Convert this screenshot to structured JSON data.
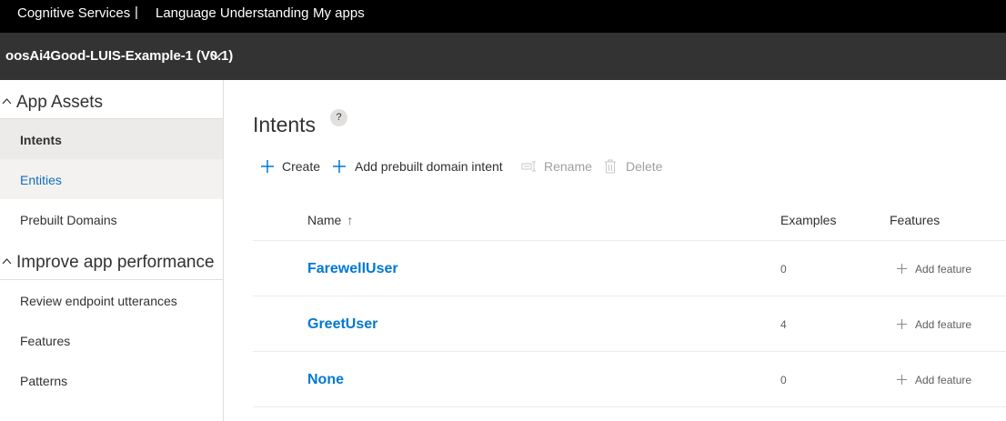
{
  "topnav": {
    "brand": "Cognitive Services",
    "separator": "|",
    "service": "Language Understanding",
    "my_apps": "My apps"
  },
  "appbar": {
    "app_name": "oosAi4Good-LUIS-Example-1 (V0.1)"
  },
  "sidebar": {
    "sections": [
      {
        "label": "App Assets",
        "items": [
          {
            "label": "Intents",
            "state": "selected"
          },
          {
            "label": "Entities",
            "state": "hover"
          },
          {
            "label": "Prebuilt Domains",
            "state": "normal"
          }
        ]
      },
      {
        "label": "Improve app performance",
        "items": [
          {
            "label": "Review endpoint utterances",
            "state": "normal"
          },
          {
            "label": "Features",
            "state": "normal"
          },
          {
            "label": "Patterns",
            "state": "normal"
          }
        ]
      }
    ]
  },
  "main": {
    "title": "Intents",
    "help": "?",
    "toolbar": {
      "create": "Create",
      "add_prebuilt": "Add prebuilt domain intent",
      "rename": "Rename",
      "delete": "Delete"
    },
    "table": {
      "columns": {
        "name": "Name",
        "sort_indicator": "↑",
        "examples": "Examples",
        "features": "Features"
      },
      "rows": [
        {
          "name": "FarewellUser",
          "examples": "0",
          "feature_action": "Add feature"
        },
        {
          "name": "GreetUser",
          "examples": "4",
          "feature_action": "Add feature"
        },
        {
          "name": "None",
          "examples": "0",
          "feature_action": "Add feature"
        }
      ]
    }
  },
  "colors": {
    "topnav_bg": "#000000",
    "appbar_bg": "#333333",
    "accent": "#0078d4",
    "selected_bg": "#edebe9",
    "hover_bg": "#f3f2f1",
    "disabled_text": "#a19f9d"
  }
}
